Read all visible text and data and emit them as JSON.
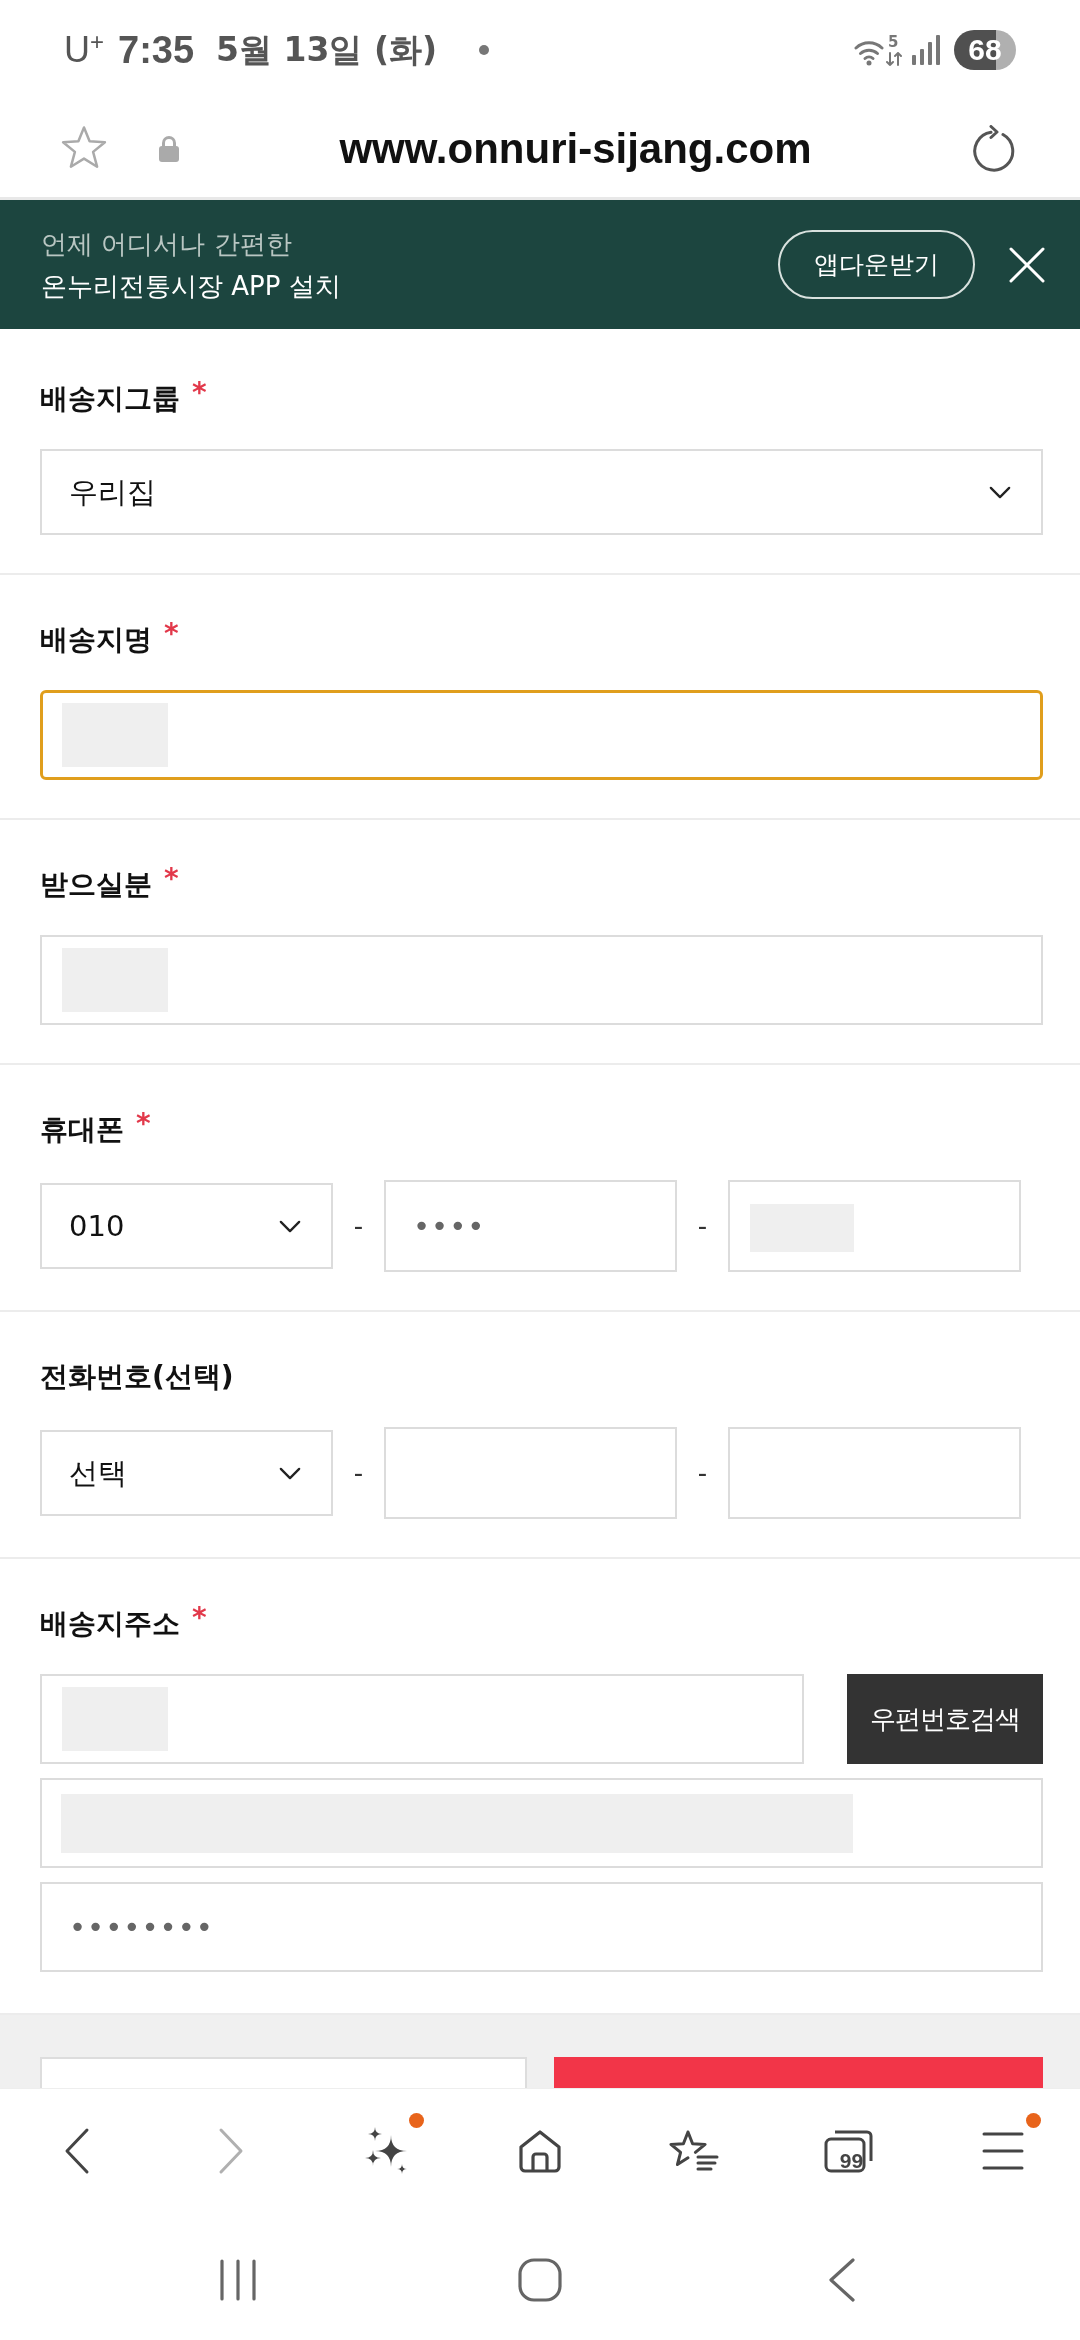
{
  "status_bar": {
    "carrier": "U$^{+}$",
    "time": "7:35",
    "date": "5월 13일 (화)",
    "wifi_label": "5",
    "battery": "68"
  },
  "address_bar": {
    "url": "www.onnuri-sijang.com"
  },
  "app_banner": {
    "tagline": "언제 어디서나 간편한",
    "title": "온누리전통시장 APP 설치",
    "button": "앱다운받기"
  },
  "form": {
    "sections": [
      {
        "label": "배송지그룹",
        "required_mark": "*",
        "rows": [
          [
            {
              "kind": "select",
              "value": "우리집",
              "focused": false
            }
          ]
        ]
      },
      {
        "label": "배송지명",
        "required_mark": "*",
        "rows": [
          [
            {
              "kind": "input",
              "focused": true,
              "redaction": {
                "kind": "short"
              }
            }
          ]
        ]
      },
      {
        "label": "받으실분",
        "required_mark": "*",
        "rows": [
          [
            {
              "kind": "input",
              "focused": false,
              "redaction": {
                "kind": "short"
              }
            }
          ]
        ]
      },
      {
        "label": "휴대폰",
        "required_mark": "*",
        "rows": [
          [
            {
              "kind": "select",
              "value": "010",
              "focused": false
            },
            {
              "kind": "separator",
              "text": "-"
            },
            {
              "kind": "input",
              "value": "••••",
              "focused": false
            },
            {
              "kind": "separator",
              "text": "-"
            },
            {
              "kind": "input",
              "focused": false,
              "redaction": {
                "kind": "small"
              }
            }
          ]
        ]
      },
      {
        "label": "전화번호(선택)",
        "rows": [
          [
            {
              "kind": "select",
              "value": "선택",
              "focused": false
            },
            {
              "kind": "separator",
              "text": "-"
            },
            {
              "kind": "input",
              "focused": false
            },
            {
              "kind": "separator",
              "text": "-"
            },
            {
              "kind": "input",
              "focused": false
            }
          ]
        ]
      },
      {
        "label": "배송지주소",
        "required_mark": "*",
        "rows": [
          [
            {
              "kind": "input",
              "focused": false,
              "redaction": {
                "kind": "short"
              }
            },
            {
              "kind": "button",
              "text": "우편번호검색"
            }
          ],
          [
            {
              "kind": "input",
              "focused": false,
              "redaction": {
                "kind": "long"
              }
            }
          ],
          [
            {
              "kind": "input",
              "value": "••••••••",
              "focused": false
            }
          ]
        ]
      }
    ]
  },
  "action_buttons": [
    {
      "kind": "outline"
    },
    {
      "kind": "filled"
    }
  ],
  "browser_toolbar": [
    {
      "kind": "back",
      "disabled": false,
      "badge": false
    },
    {
      "kind": "forward",
      "disabled": true,
      "badge": false
    },
    {
      "kind": "assistant",
      "disabled": false,
      "badge": true
    },
    {
      "kind": "home",
      "disabled": false,
      "badge": false
    },
    {
      "kind": "bookmarks",
      "disabled": false,
      "badge": false
    },
    {
      "kind": "tabs",
      "count": "99",
      "disabled": false,
      "badge": false
    },
    {
      "kind": "menu",
      "disabled": false,
      "badge": true
    }
  ]
}
